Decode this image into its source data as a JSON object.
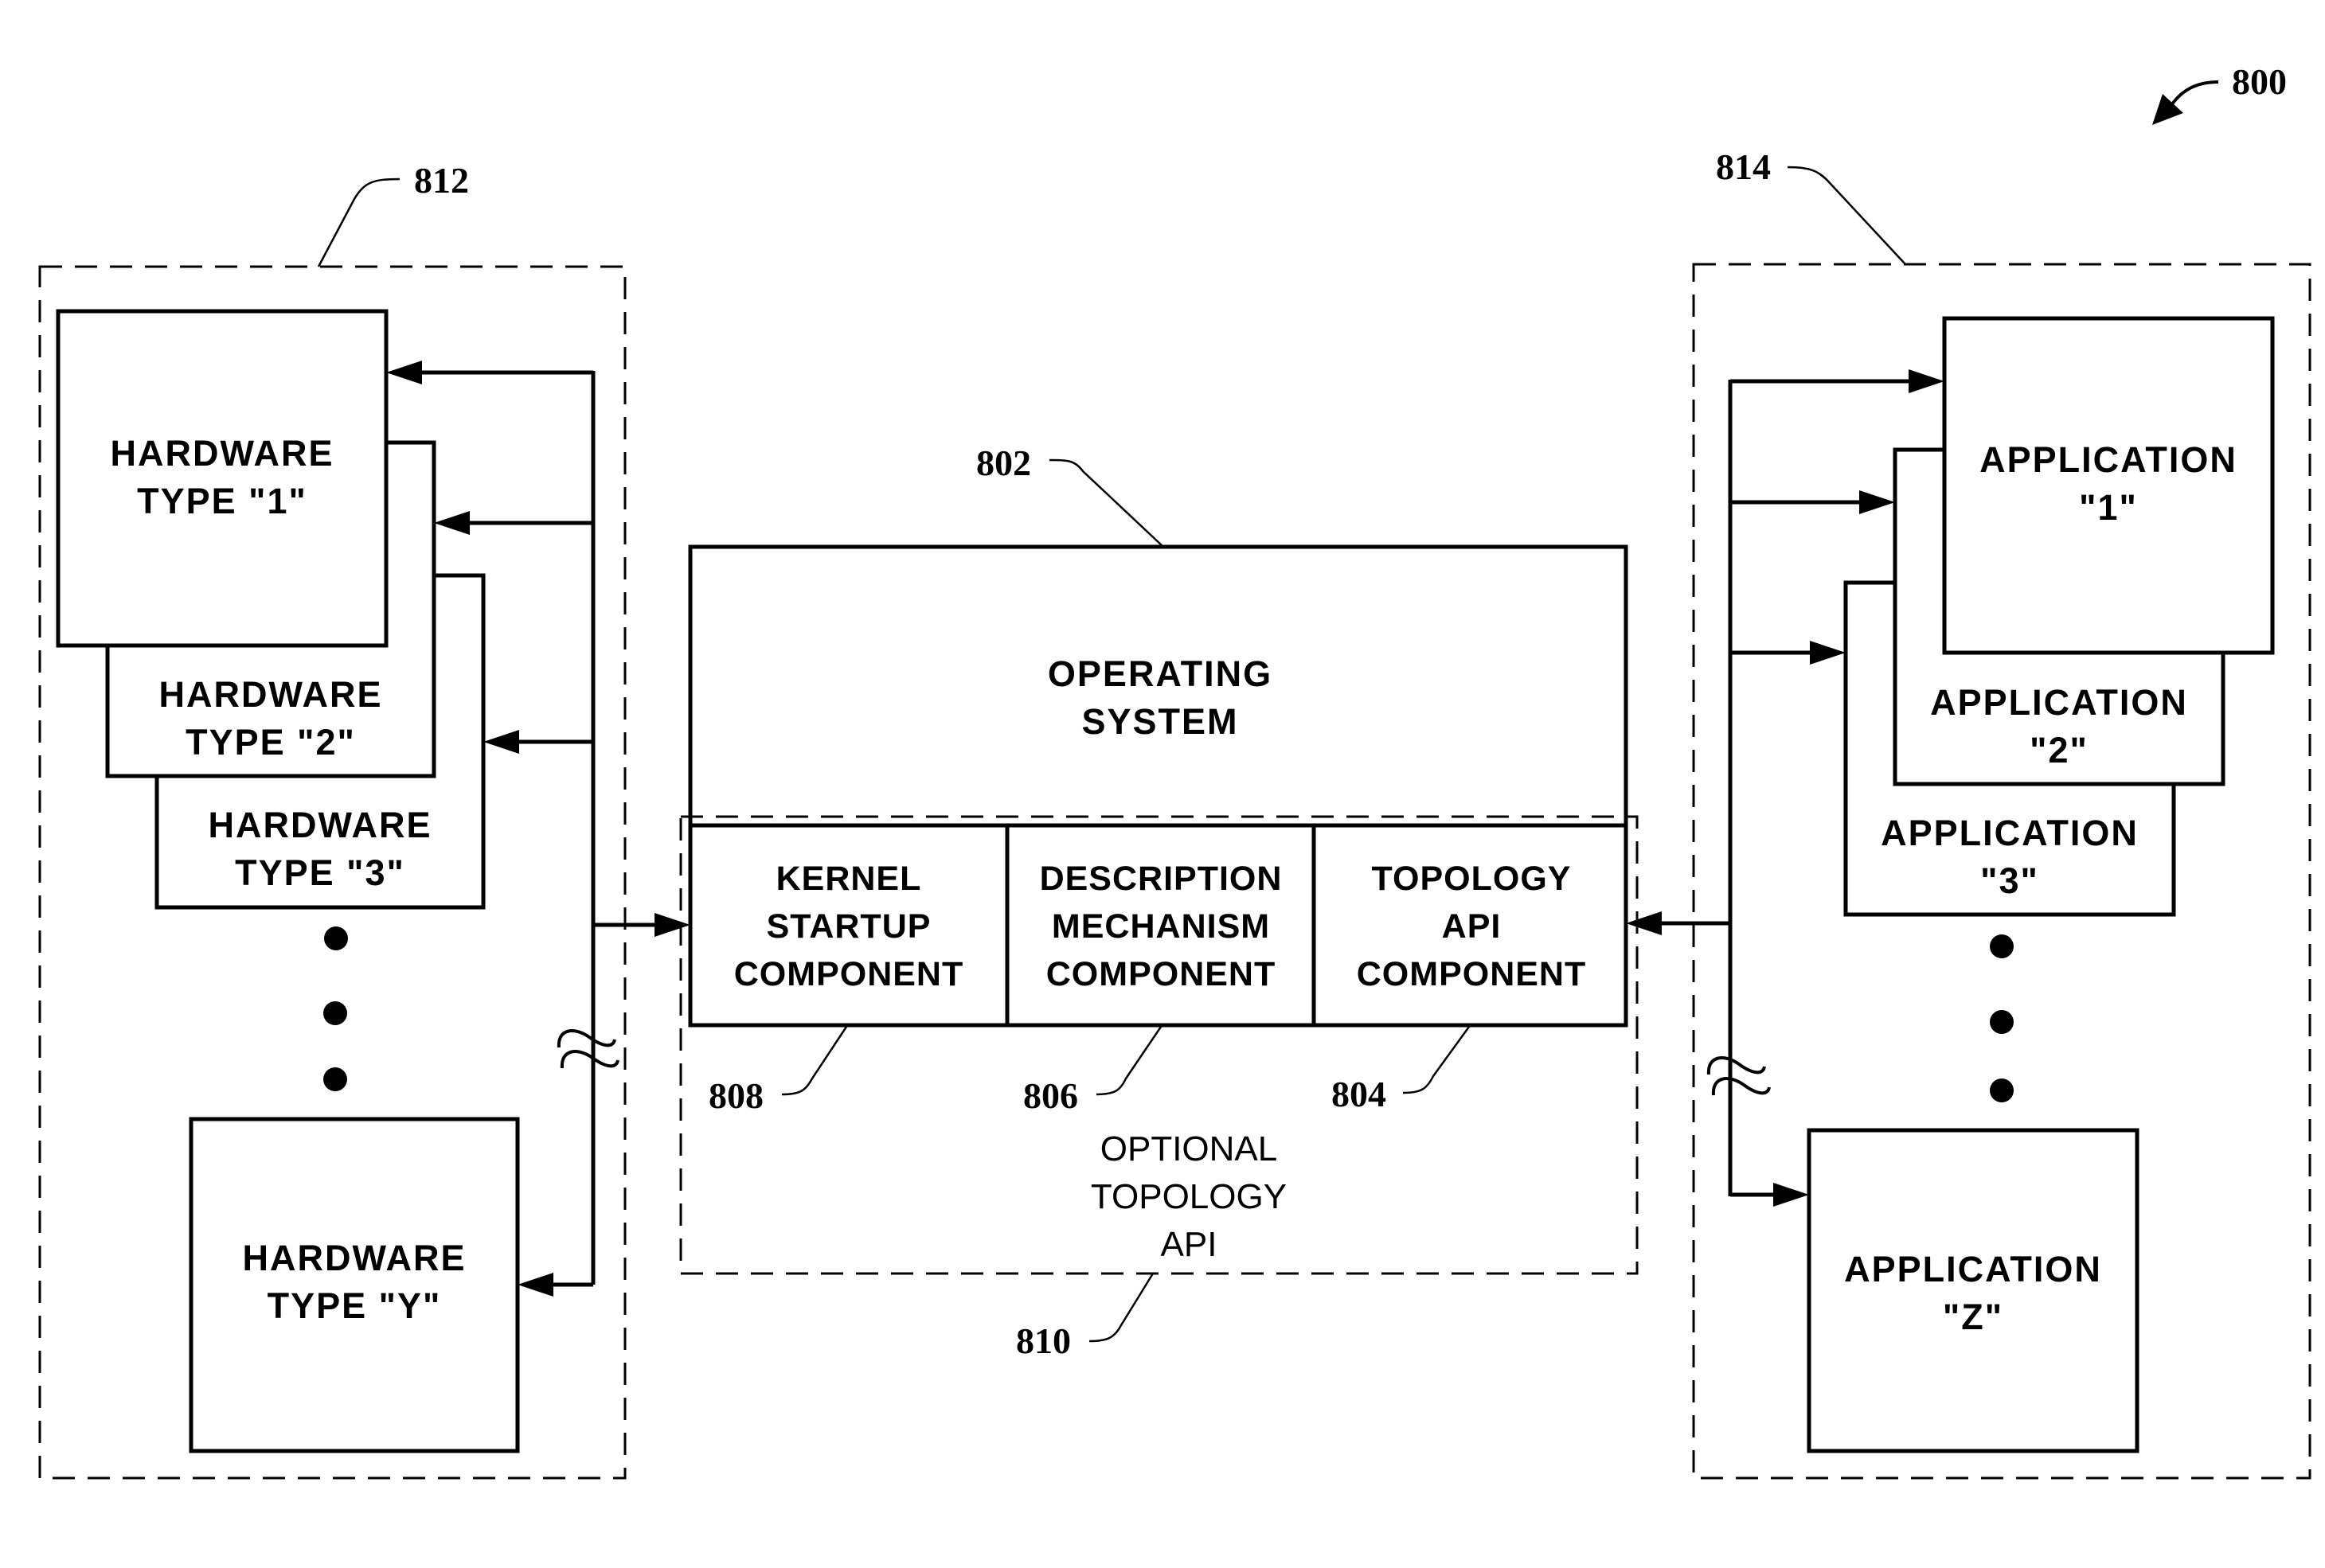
{
  "figure": {
    "ref": "800",
    "colors": {
      "ink": "#000000",
      "paper": "#ffffff"
    }
  },
  "hardware_group": {
    "ref": "812",
    "items": [
      {
        "line1": "HARDWARE",
        "line2": "TYPE \"1\""
      },
      {
        "line1": "HARDWARE",
        "line2": "TYPE \"2\""
      },
      {
        "line1": "HARDWARE",
        "line2": "TYPE \"3\""
      },
      {
        "line1": "HARDWARE",
        "line2": "TYPE \"Y\""
      }
    ]
  },
  "operating_system": {
    "ref": "802",
    "line1": "OPERATING",
    "line2": "SYSTEM",
    "components": [
      {
        "ref": "808",
        "line1": "KERNEL",
        "line2": "STARTUP",
        "line3": "COMPONENT"
      },
      {
        "ref": "806",
        "line1": "DESCRIPTION",
        "line2": "MECHANISM",
        "line3": "COMPONENT"
      },
      {
        "ref": "804",
        "line1": "TOPOLOGY",
        "line2": "API",
        "line3": "COMPONENT"
      }
    ]
  },
  "optional_api": {
    "ref": "810",
    "line1": "OPTIONAL",
    "line2": "TOPOLOGY",
    "line3": "API"
  },
  "application_group": {
    "ref": "814",
    "items": [
      {
        "line1": "APPLICATION",
        "line2": "\"1\""
      },
      {
        "line1": "APPLICATION",
        "line2": "\"2\""
      },
      {
        "line1": "APPLICATION",
        "line2": "\"3\""
      },
      {
        "line1": "APPLICATION",
        "line2": "\"Z\""
      }
    ]
  }
}
